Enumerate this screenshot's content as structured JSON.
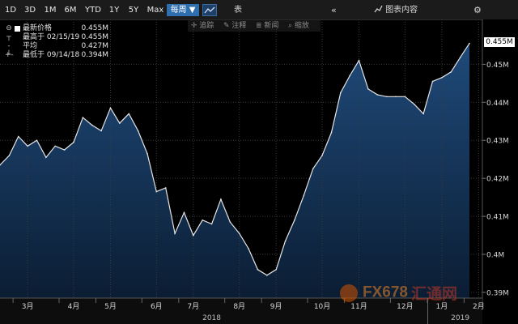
{
  "toolbar": {
    "ranges": [
      "1D",
      "3D",
      "1M",
      "6M",
      "YTD",
      "1Y",
      "5Y",
      "Max"
    ],
    "frequency": "每周 ▼",
    "chart_icon": "line-chart-icon",
    "table_label": "表",
    "collapse_icon": "double-chevron-left-icon",
    "content_label": "图表内容",
    "content_icon": "chart-content-icon",
    "settings_icon": "gear-icon"
  },
  "annotations_bar": {
    "track": "追踪",
    "annotate": "注释",
    "news": "新闻",
    "zoom": "缩放"
  },
  "legend": [
    {
      "label": "最新价格",
      "value": "0.455M"
    },
    {
      "label": "最高于 02/15/19",
      "value": "0.455M"
    },
    {
      "label": "平均",
      "value": "0.427M"
    },
    {
      "label": "最低于 09/14/18",
      "value": "0.394M"
    }
  ],
  "price_badge": "0.455M",
  "watermark": {
    "a": "FX678",
    "b": "汇通网"
  },
  "colors": {
    "background": "#000000",
    "line": "#e6e6e6",
    "area_top": "#1f4a7a",
    "area_bottom": "#0b1d33",
    "grid": "#3a3a3a",
    "frequency_active": "#2f6fb0"
  },
  "chart_data": {
    "type": "area",
    "ylim": [
      0.3885,
      0.4618
    ],
    "y_ticks": [
      0.39,
      0.4,
      0.41,
      0.42,
      0.43,
      0.44,
      0.45
    ],
    "y_tick_labels": [
      "0.39M",
      "0.4M",
      "0.41M",
      "0.42M",
      "0.43M",
      "0.44M",
      "0.45M"
    ],
    "x_month_labels": [
      {
        "label": "3月",
        "week": 3
      },
      {
        "label": "4月",
        "week": 8
      },
      {
        "label": "5月",
        "week": 12
      },
      {
        "label": "6月",
        "week": 17
      },
      {
        "label": "7月",
        "week": 21
      },
      {
        "label": "8月",
        "week": 26
      },
      {
        "label": "9月",
        "week": 30
      },
      {
        "label": "10月",
        "week": 35
      },
      {
        "label": "11月",
        "week": 39
      },
      {
        "label": "12月",
        "week": 44
      },
      {
        "label": "1月",
        "week": 48
      },
      {
        "label": "2月",
        "week": 52
      }
    ],
    "x_year_labels": [
      {
        "label": "2018",
        "week": 23
      },
      {
        "label": "2019",
        "week": 50
      }
    ],
    "year_boundary_week": 47,
    "grid": true,
    "values": [
      0.4235,
      0.426,
      0.431,
      0.4285,
      0.43,
      0.4255,
      0.4285,
      0.4275,
      0.4295,
      0.436,
      0.434,
      0.4325,
      0.4385,
      0.4345,
      0.437,
      0.4325,
      0.4265,
      0.4165,
      0.4175,
      0.4055,
      0.411,
      0.405,
      0.409,
      0.408,
      0.4145,
      0.4085,
      0.4055,
      0.4015,
      0.396,
      0.3945,
      0.396,
      0.4035,
      0.409,
      0.4155,
      0.4225,
      0.426,
      0.432,
      0.4425,
      0.447,
      0.451,
      0.4435,
      0.442,
      0.4415,
      0.4415,
      0.4415,
      0.4395,
      0.437,
      0.4455,
      0.4465,
      0.448,
      0.4518,
      0.4555
    ]
  }
}
